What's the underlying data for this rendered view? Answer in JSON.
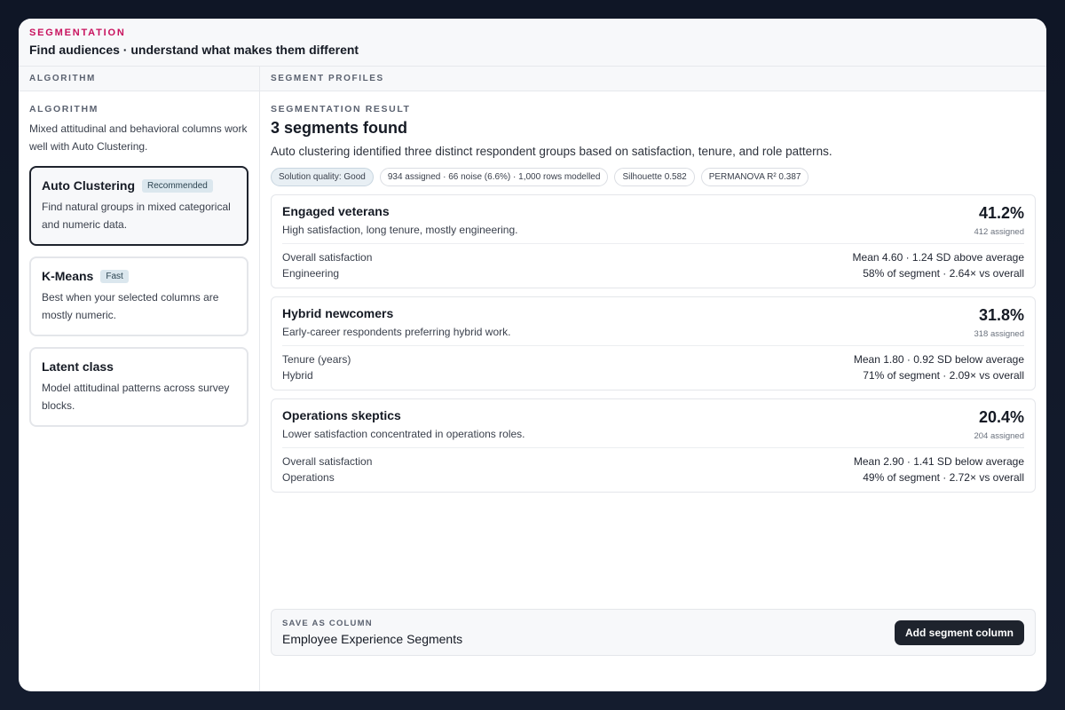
{
  "header": {
    "kicker": "SEGMENTATION",
    "title": "Find audiences · understand what makes them different"
  },
  "left": {
    "column_heading": "ALGORITHM",
    "section_label": "ALGORITHM",
    "description": "Mixed attitudinal and behavioral columns work well with Auto Clustering.",
    "algorithms": [
      {
        "name": "Auto Clustering",
        "badge": "Recommended",
        "description": "Find natural groups in mixed categorical and numeric data.",
        "selected": true
      },
      {
        "name": "K-Means",
        "badge": "Fast",
        "description": "Best when your selected columns are mostly numeric.",
        "selected": false
      },
      {
        "name": "Latent class",
        "badge": "",
        "description": "Model attitudinal patterns across survey blocks.",
        "selected": false
      }
    ]
  },
  "right": {
    "column_heading": "SEGMENT PROFILES",
    "section_label": "SEGMENTATION RESULT",
    "result_title": "3 segments found",
    "result_description": "Auto clustering identified three distinct respondent groups based on satisfaction, tenure, and role patterns.",
    "pills": [
      "Solution quality: Good",
      "934 assigned · 66 noise (6.6%) · 1,000 rows modelled",
      "Silhouette 0.582",
      "PERMANOVA R² 0.387"
    ],
    "segments": [
      {
        "name": "Engaged veterans",
        "description": "High satisfaction, long tenure, mostly engineering.",
        "percent": "41.2%",
        "assigned": "412 assigned",
        "rows": [
          {
            "label": "Overall satisfaction",
            "value": "Mean 4.60 · 1.24 SD above average"
          },
          {
            "label": "Engineering",
            "value": "58% of segment · 2.64× vs overall"
          }
        ]
      },
      {
        "name": "Hybrid newcomers",
        "description": "Early-career respondents preferring hybrid work.",
        "percent": "31.8%",
        "assigned": "318 assigned",
        "rows": [
          {
            "label": "Tenure (years)",
            "value": "Mean 1.80 · 0.92 SD below average"
          },
          {
            "label": "Hybrid",
            "value": "71% of segment · 2.09× vs overall"
          }
        ]
      },
      {
        "name": "Operations skeptics",
        "description": "Lower satisfaction concentrated in operations roles.",
        "percent": "20.4%",
        "assigned": "204 assigned",
        "rows": [
          {
            "label": "Overall satisfaction",
            "value": "Mean 2.90 · 1.41 SD below average"
          },
          {
            "label": "Operations",
            "value": "49% of segment · 2.72× vs overall"
          }
        ]
      }
    ],
    "save": {
      "label": "SAVE AS COLUMN",
      "value": "Employee Experience Segments",
      "button_label": "Add segment column"
    }
  }
}
